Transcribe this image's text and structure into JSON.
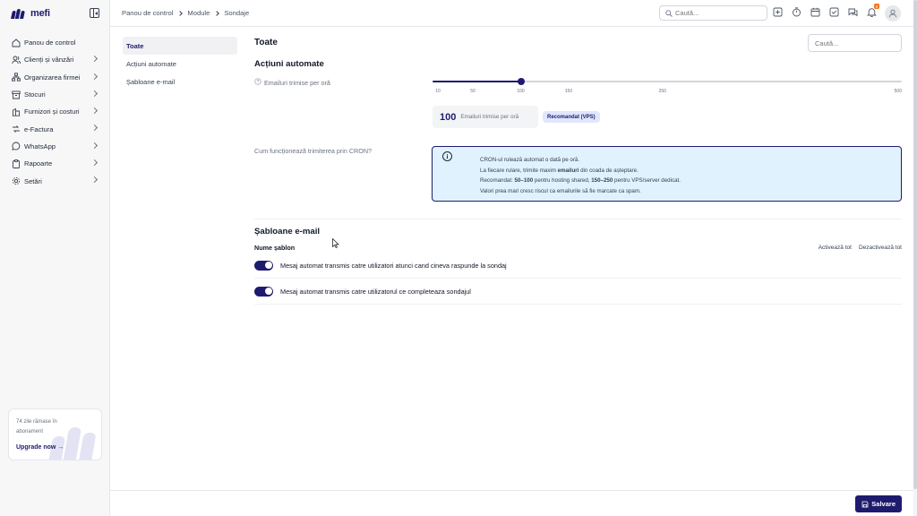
{
  "app": {
    "logo_text": "mefi"
  },
  "sidebar": {
    "items": [
      {
        "label": "Panou de control",
        "icon": "home-icon",
        "chevron": false
      },
      {
        "label": "Clienți și vânzări",
        "icon": "users-icon",
        "chevron": true
      },
      {
        "label": "Organizarea firmei",
        "icon": "org-chart-icon",
        "chevron": true
      },
      {
        "label": "Stocuri",
        "icon": "box-icon",
        "chevron": true
      },
      {
        "label": "Furnizori și costuri",
        "icon": "building-icon",
        "chevron": true
      },
      {
        "label": "e-Factura",
        "icon": "invoice-icon",
        "chevron": true
      },
      {
        "label": "WhatsApp",
        "icon": "chat-icon",
        "chevron": true
      },
      {
        "label": "Rapoarte",
        "icon": "clipboard-icon",
        "chevron": true
      },
      {
        "label": "Setări",
        "icon": "gear-icon",
        "chevron": true
      }
    ],
    "promo": {
      "text": "74 zile rămase în abonament",
      "link": "Upgrade now"
    }
  },
  "topbar": {
    "breadcrumb": [
      "Panou de control",
      "Module",
      "Sondaje"
    ],
    "search_placeholder": "Caută...",
    "icons": [
      "add-icon",
      "timer-icon",
      "calendar-icon",
      "checkbox-icon",
      "messages-icon",
      "bell-icon"
    ],
    "notification_count": "0"
  },
  "subnav": {
    "items": [
      {
        "label": "Toate",
        "active": true
      },
      {
        "label": "Acțiuni automate",
        "active": false
      },
      {
        "label": "Șabloane e-mail",
        "active": false
      }
    ]
  },
  "main": {
    "title": "Toate",
    "search_placeholder": "Caută...",
    "automation": {
      "title": "Acțiuni automate",
      "emails_label": "Emailuri trimise per oră",
      "slider": {
        "min": 10,
        "max": 500,
        "value": 100,
        "ticks": [
          10,
          50,
          100,
          150,
          250,
          500
        ]
      },
      "value_display": "100",
      "value_unit": "Emailuri trimise per oră",
      "badge": "Recomandat (VPS)",
      "cron_label": "Cum funcționează trimiterea prin CRON?",
      "info": {
        "line1": "CRON-ul rulează automat o dată pe oră.",
        "line2_pre": "La fiecare rulare, trimite maxim ",
        "line2_bold": "emailuri",
        "line2_post": " din coada de așteptare.",
        "line3_pre": "Recomandat: ",
        "line3_bold1": "50–100",
        "line3_mid": " pentru hosting shared, ",
        "line3_bold2": "150–250",
        "line3_post": " pentru VPS/server dedicat.",
        "line4": "Valori prea mari cresc riscul ca emailurile să fie marcate ca spam."
      }
    },
    "templates": {
      "title": "Șabloane e-mail",
      "column_header": "Nume șablon",
      "activate_all": "Activează tot",
      "deactivate_all": "Dezactivează tot",
      "rows": [
        {
          "name": "Mesaj automat transmis catre utilizatori atunci cand cineva raspunde la sondaj",
          "enabled": true
        },
        {
          "name": "Mesaj automat transmis catre utilizatorul ce completeaza sondajul",
          "enabled": true
        }
      ]
    }
  },
  "footer": {
    "save_label": "Salvare"
  },
  "colors": {
    "primary": "#1e1b6e",
    "info_bg": "#e0f2fe",
    "badge_bg": "#e0e7ff",
    "notification": "#f97316"
  }
}
